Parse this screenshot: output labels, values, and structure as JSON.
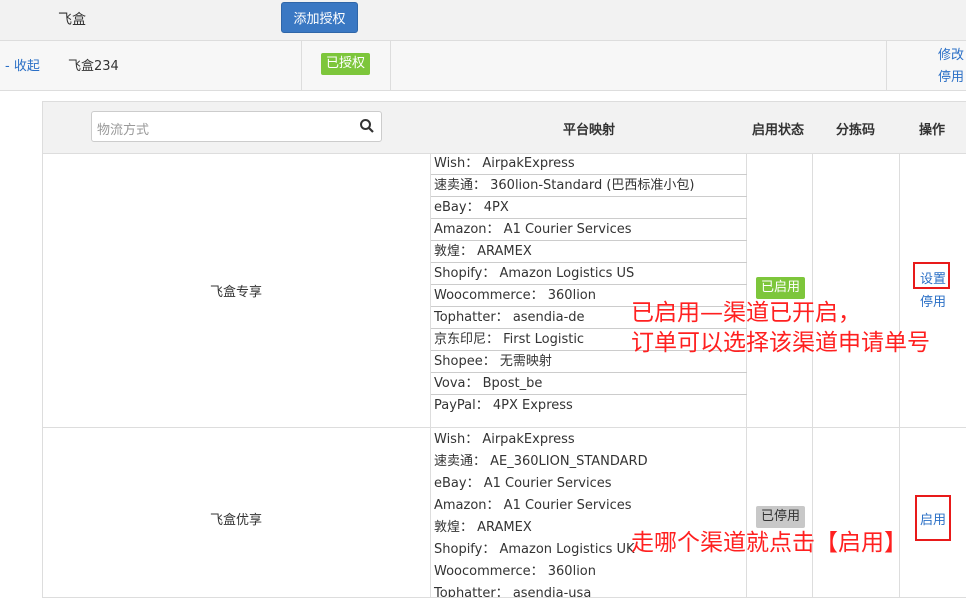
{
  "top": {
    "title": "飞盒",
    "add_button": "添加授权"
  },
  "auth_row": {
    "collapse": "- 收起",
    "name": "飞盒234",
    "status": "已授权",
    "action_edit": "修改",
    "action_disable": "停用"
  },
  "table": {
    "search_placeholder": "物流方式",
    "headers": {
      "mapping": "平台映射",
      "status": "启用状态",
      "sort_code": "分拣码",
      "ops": "操作"
    },
    "rows": [
      {
        "name": "飞盒专享",
        "mappings": [
          "Wish： AirpakExpress",
          "速卖通： 360lion-Standard (巴西标准小包)",
          "eBay： 4PX",
          "Amazon： A1 Courier Services",
          "敦煌： ARAMEX",
          "Shopify： Amazon Logistics US",
          "Woocommerce： 360lion",
          "Tophatter： asendia-de",
          "京东印尼： First Logistic",
          "Shopee： 无需映射",
          "Vova： Bpost_be",
          "PayPal： 4PX Express"
        ],
        "status": "已启用",
        "op1": "设置",
        "op2": "停用"
      },
      {
        "name": "飞盒优享",
        "mappings": [
          "Wish： AirpakExpress",
          "速卖通： AE_360LION_STANDARD",
          "eBay： A1 Courier Services",
          "Amazon： A1 Courier Services",
          "敦煌： ARAMEX",
          "Shopify： Amazon Logistics UK",
          "Woocommerce： 360lion",
          "Tophatter： asendia-usa"
        ],
        "status": "已停用",
        "op1": "启用"
      }
    ]
  },
  "annotations": {
    "note1_line1": "已启用—渠道已开启，",
    "note1_line2": "订单可以选择该渠道申请单号",
    "note2": "走哪个渠道就点击【启用】"
  },
  "colors": {
    "primary": "#3a78c3",
    "enabled": "#7dc63b",
    "disabled": "#c8c8c8",
    "annotation": "#ff2020"
  }
}
